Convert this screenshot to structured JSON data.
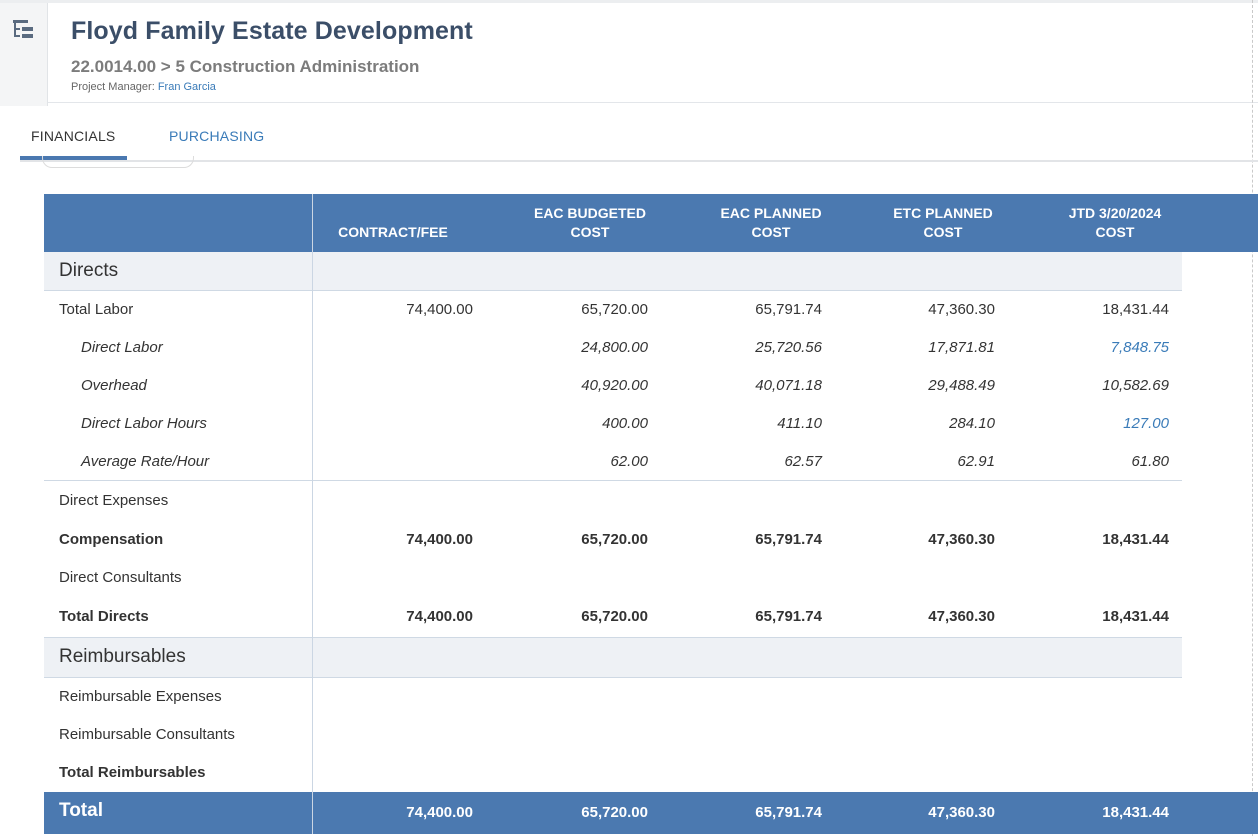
{
  "header": {
    "title": "Floyd Family Estate Development",
    "subtitle": "22.0014.00 > 5 Construction Administration",
    "pm_label": "Project Manager: ",
    "pm_name": "Fran Garcia"
  },
  "tabs": [
    {
      "label": "FINANCIALS",
      "active": true
    },
    {
      "label": "PURCHASING",
      "active": false
    }
  ],
  "columns": [
    {
      "line1": "",
      "line2": "CONTRACT/FEE"
    },
    {
      "line1": "EAC BUDGETED",
      "line2": "COST"
    },
    {
      "line1": "EAC PLANNED",
      "line2": "COST"
    },
    {
      "line1": "ETC PLANNED",
      "line2": "COST"
    },
    {
      "line1": "JTD 3/20/2024",
      "line2": "COST"
    }
  ],
  "sections": {
    "directs": "Directs",
    "reimbursables": "Reimbursables"
  },
  "rows": {
    "total_labor": {
      "label": "Total Labor",
      "values": [
        "74,400.00",
        "65,720.00",
        "65,791.74",
        "47,360.30",
        "18,431.44"
      ]
    },
    "direct_labor": {
      "label": "Direct Labor",
      "values": [
        "",
        "24,800.00",
        "25,720.56",
        "17,871.81",
        "7,848.75"
      ]
    },
    "overhead": {
      "label": "Overhead",
      "values": [
        "",
        "40,920.00",
        "40,071.18",
        "29,488.49",
        "10,582.69"
      ]
    },
    "direct_labor_hours": {
      "label": "Direct Labor Hours",
      "values": [
        "",
        "400.00",
        "411.10",
        "284.10",
        "127.00"
      ]
    },
    "average_rate": {
      "label": "Average Rate/Hour",
      "values": [
        "",
        "62.00",
        "62.57",
        "62.91",
        "61.80"
      ]
    },
    "direct_expenses": {
      "label": "Direct Expenses",
      "values": [
        "",
        "",
        "",
        "",
        ""
      ]
    },
    "compensation": {
      "label": "Compensation",
      "values": [
        "74,400.00",
        "65,720.00",
        "65,791.74",
        "47,360.30",
        "18,431.44"
      ]
    },
    "direct_consultants": {
      "label": "Direct Consultants",
      "values": [
        "",
        "",
        "",
        "",
        ""
      ]
    },
    "total_directs": {
      "label": "Total Directs",
      "values": [
        "74,400.00",
        "65,720.00",
        "65,791.74",
        "47,360.30",
        "18,431.44"
      ]
    },
    "reimb_expenses": {
      "label": "Reimbursable Expenses",
      "values": [
        "",
        "",
        "",
        "",
        ""
      ]
    },
    "reimb_consultants": {
      "label": "Reimbursable Consultants",
      "values": [
        "",
        "",
        "",
        "",
        ""
      ]
    },
    "total_reimbursables": {
      "label": "Total Reimbursables",
      "values": [
        "",
        "",
        "",
        "",
        ""
      ]
    },
    "total": {
      "label": "Total",
      "values": [
        "74,400.00",
        "65,720.00",
        "65,791.74",
        "47,360.30",
        "18,431.44"
      ]
    }
  },
  "colors": {
    "header_blue": "#4b79b0",
    "link_blue": "#3a7bb8",
    "title_navy": "#3b4e68"
  },
  "icons": {
    "hierarchy": "hierarchy-icon"
  }
}
